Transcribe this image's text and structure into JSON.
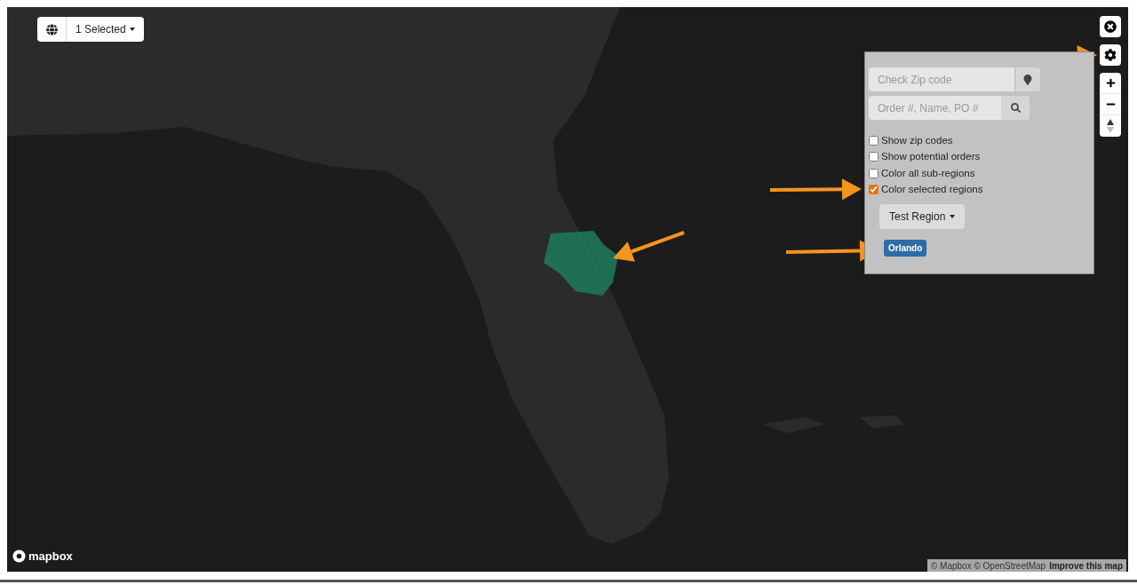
{
  "region_picker": {
    "label": "1 Selected"
  },
  "panel": {
    "zip_field": {
      "placeholder": "Check Zip code"
    },
    "search_field": {
      "placeholder": "Order #, Name, PO #"
    },
    "options": [
      {
        "label": "Show zip codes",
        "checked": false
      },
      {
        "label": "Show potential orders",
        "checked": false
      },
      {
        "label": "Color all sub-regions",
        "checked": false
      },
      {
        "label": "Color selected regions",
        "checked": true
      }
    ],
    "region_dropdown": {
      "label": "Test Region"
    },
    "tags": [
      {
        "label": "Orlando"
      }
    ]
  },
  "logo": {
    "label": "mapbox"
  },
  "attribution": {
    "text": "© Mapbox © OpenStreetMap",
    "link": "Improve this map"
  }
}
